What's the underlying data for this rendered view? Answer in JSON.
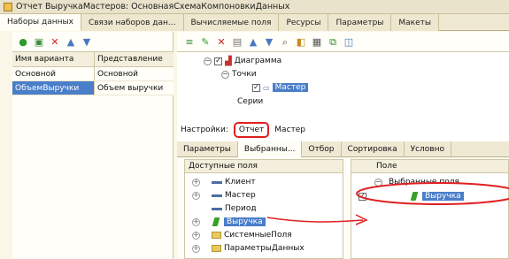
{
  "window": {
    "title": "Отчет ВыручкаМастеров: ОсновнаяСхемаКомпоновкиДанных"
  },
  "main_tabs": [
    {
      "label": "Наборы данных"
    },
    {
      "label": "Связи наборов дан..."
    },
    {
      "label": "Вычисляемые поля"
    },
    {
      "label": "Ресурсы"
    },
    {
      "label": "Параметры"
    },
    {
      "label": "Макеты"
    }
  ],
  "variants_table": {
    "columns": [
      "Имя варианта",
      "Представление"
    ],
    "rows": [
      {
        "name": "Основной",
        "view": "Основной"
      },
      {
        "name": "ОбъемВыручки",
        "view": "Объем выручки"
      }
    ]
  },
  "structure_tree": {
    "diagram": "Диаграмма",
    "points": "Точки",
    "master": "Мастер",
    "series": "Серии"
  },
  "settings": {
    "label": "Настройки:",
    "report_button": "Отчет",
    "master_label": "Мастер"
  },
  "settings_tabs": [
    {
      "label": "Параметры"
    },
    {
      "label": "Выбранны..."
    },
    {
      "label": "Отбор"
    },
    {
      "label": "Сортировка"
    },
    {
      "label": "Условно"
    }
  ],
  "available_fields": {
    "header": "Доступные поля",
    "items": [
      "Клиент",
      "Мастер",
      "Период",
      "Выручка",
      "СистемныеПоля",
      "ПараметрыДанных"
    ]
  },
  "selected_fields": {
    "header": "Поле",
    "group": "Выбранные поля",
    "item": "Выручка"
  },
  "colors": {
    "annotation": "#e02020",
    "selection": "#4a7ec9"
  }
}
